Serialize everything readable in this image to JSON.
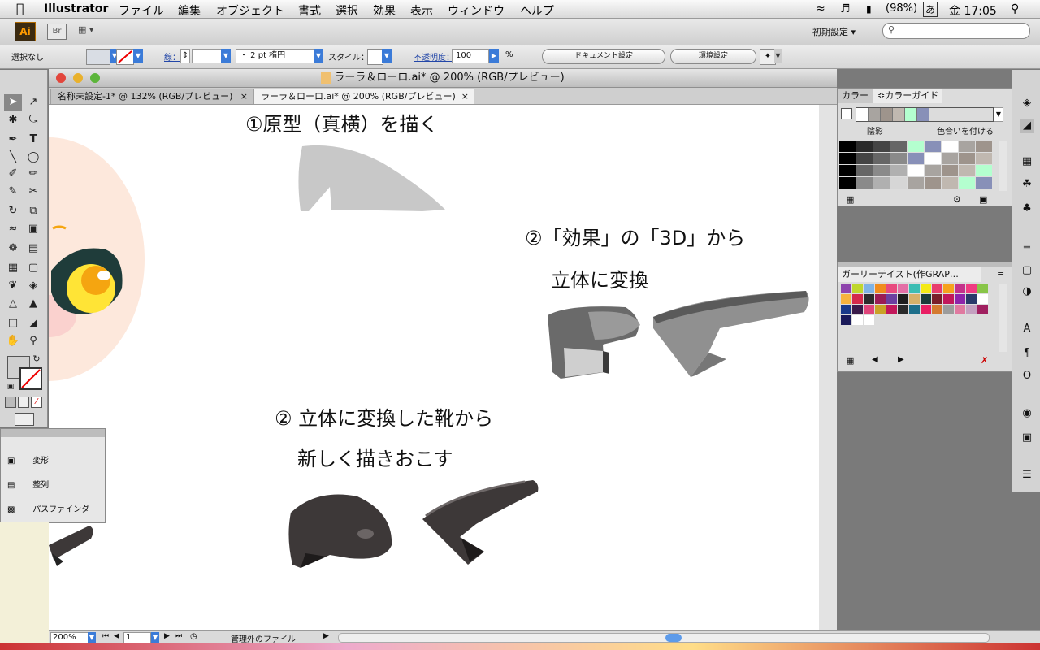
{
  "menubar": {
    "app": "Illustrator",
    "items": [
      "ファイル",
      "編集",
      "オブジェクト",
      "書式",
      "選択",
      "効果",
      "表示",
      "ウィンドウ",
      "ヘルプ"
    ],
    "battery": "(98%)",
    "ime": "あ",
    "clock": "金 17:05"
  },
  "appbar": {
    "ai_logo": "Ai",
    "br_logo": "Br",
    "workspace": "初期設定 ▾"
  },
  "control": {
    "selection": "選択なし",
    "stroke_label": "線：",
    "stroke_brush": "・ 2 pt 楕円",
    "style_label": "スタイル：",
    "opacity_label": "不透明度：",
    "opacity_value": "100",
    "percent": "%",
    "doc_settings": "ドキュメント設定",
    "prefs": "環境設定"
  },
  "window": {
    "title": "ラーラ＆ローロ.ai* @ 200% (RGB/プレビュー)"
  },
  "tabs": [
    {
      "label": "名称未設定-1* @ 132% (RGB/プレビュー)",
      "close": "×"
    },
    {
      "label": "ラーラ＆ローロ.ai* @ 200% (RGB/プレビュー)",
      "close": "×"
    }
  ],
  "canvas": {
    "note1": "①原型（真横）を描く",
    "note2a": "②「効果」の「3D」から",
    "note2b": "立体に変換",
    "note3a": "② 立体に変換した靴から",
    "note3b": "新しく描きおこす"
  },
  "minipanel": {
    "items": [
      "変形",
      "整列",
      "パスファインダ"
    ]
  },
  "color_panel": {
    "tab_color": "カラー",
    "tab_guide": "≎カラーガイド",
    "shade_label": "陰影",
    "tint_label": "色合いを付ける",
    "guide_colors": [
      "#ffffff",
      "#a8a4a0",
      "#9e948c",
      "#c0b8b0",
      "#b4ffcf",
      "#8890b8"
    ]
  },
  "swatch_panel": {
    "title": "ガーリーテイスト(作GRAP…",
    "swatches": [
      "#8e44ad",
      "#c0d72e",
      "#7fb3e5",
      "#f08c1e",
      "#e84a7f",
      "#e46fa6",
      "#3cbdb3",
      "#f4e916",
      "#e83e6c",
      "#f6a21d",
      "#c4318a",
      "#f03b82",
      "#88c548",
      "#f7b33e",
      "#d42a4c",
      "#2c2c2c",
      "#9b1c55",
      "#6b3fa0",
      "#1e1e1e",
      "#d6b16a",
      "#1b3a3a",
      "#7a1e2a",
      "#c2185b",
      "#8e24aa",
      "#2a3a6a",
      "#ffffff",
      "#1a3a8a",
      "#3a1a4a",
      "#e0457b",
      "#c9a227",
      "#c2185b",
      "#2a2a2a",
      "#1e6f8a",
      "#e91e63",
      "#d47a30",
      "#9c9c9c",
      "#e07aa0",
      "#c4a0c0",
      "#a02060",
      "#1a1a5a",
      "#ffffff",
      "#ffffff"
    ]
  },
  "status": {
    "zoom": "200%",
    "page": "1",
    "file_status": "管理外のファイル"
  }
}
